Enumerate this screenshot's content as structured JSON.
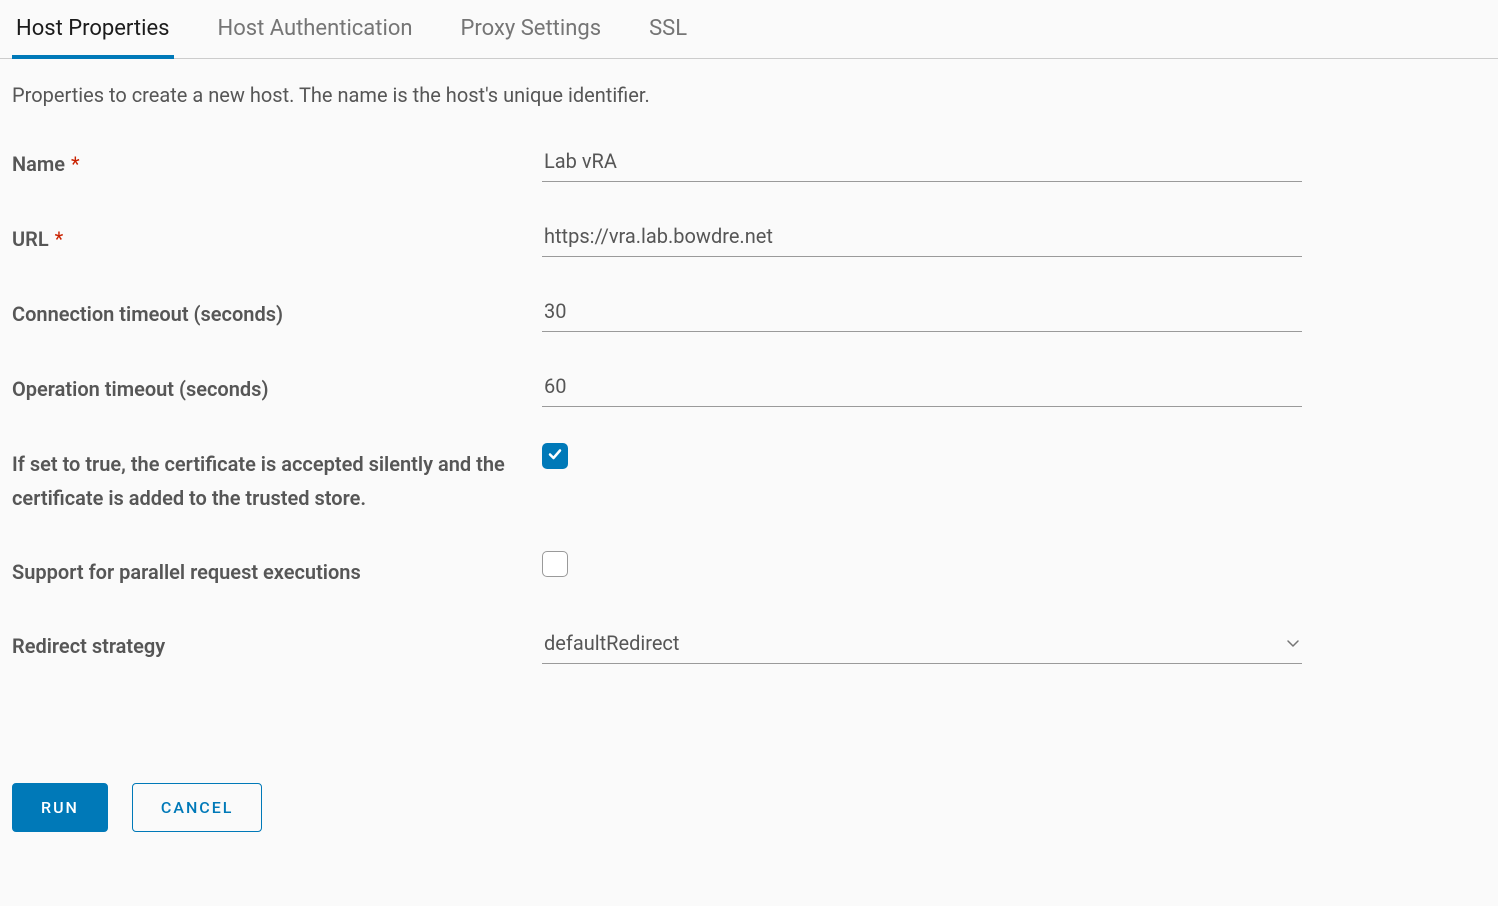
{
  "tabs": [
    {
      "label": "Host Properties",
      "active": true
    },
    {
      "label": "Host Authentication",
      "active": false
    },
    {
      "label": "Proxy Settings",
      "active": false
    },
    {
      "label": "SSL",
      "active": false
    }
  ],
  "description": "Properties to create a new host. The name is the host's unique identifier.",
  "fields": {
    "name": {
      "label": "Name",
      "required": true,
      "value": "Lab vRA"
    },
    "url": {
      "label": "URL",
      "required": true,
      "value": "https://vra.lab.bowdre.net"
    },
    "connection_timeout": {
      "label": "Connection timeout (seconds)",
      "required": false,
      "value": "30"
    },
    "operation_timeout": {
      "label": "Operation timeout (seconds)",
      "required": false,
      "value": "60"
    },
    "accept_cert": {
      "label": "If set to true, the certificate is accepted silently and the certificate is added to the trusted store.",
      "checked": true
    },
    "parallel_requests": {
      "label": "Support for parallel request executions",
      "checked": false
    },
    "redirect_strategy": {
      "label": "Redirect strategy",
      "value": "defaultRedirect"
    }
  },
  "buttons": {
    "run": "RUN",
    "cancel": "CANCEL"
  }
}
